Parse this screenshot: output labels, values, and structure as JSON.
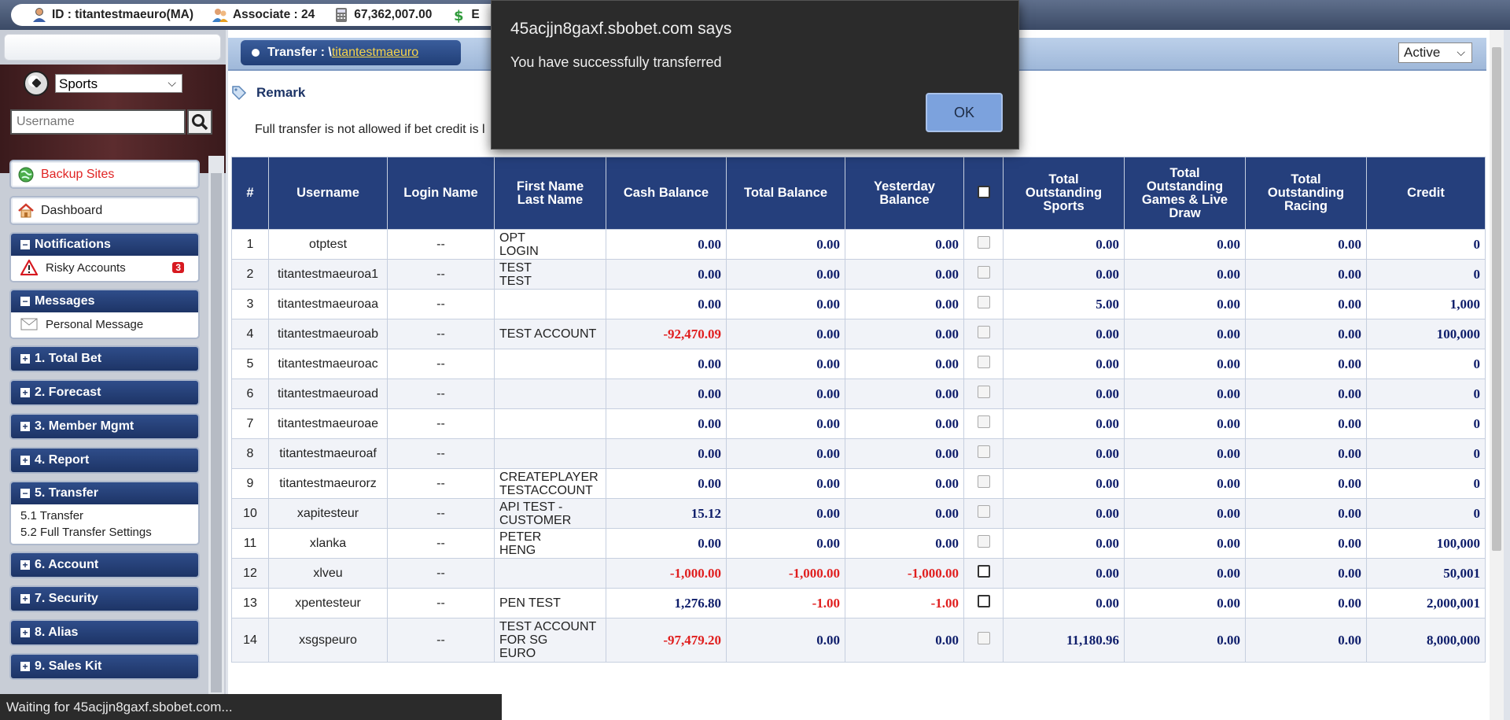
{
  "topbar": {
    "id_text": "ID : titantestmaeuro(MA)",
    "associate_text": "Associate : 24",
    "balance_text": "67,362,007.00",
    "extra_text": "E"
  },
  "sidebar": {
    "sport_selected": "Sports",
    "search_placeholder": "Username",
    "backup_label": "Backup Sites",
    "dashboard_label": "Dashboard",
    "notifications": {
      "title": "Notifications",
      "risky_label": "Risky Accounts",
      "risky_count": "3"
    },
    "messages": {
      "title": "Messages",
      "personal_label": "Personal Message"
    },
    "groups": [
      "1. Total Bet",
      "2. Forecast",
      "3. Member Mgmt",
      "4. Report"
    ],
    "transfer": {
      "title": "5. Transfer",
      "items": [
        "5.1 Transfer",
        "5.2 Full Transfer Settings"
      ]
    },
    "groups2": [
      "6. Account",
      "7. Security",
      "8. Alias",
      "9. Sales Kit"
    ]
  },
  "main": {
    "tab_prefix": "Transfer : \\",
    "tab_link": "titantestmaeuro",
    "status_selected": "Active",
    "remark_title": "Remark",
    "note": "Full transfer is not allowed if bet credit is l",
    "columns": [
      "#",
      "Username",
      "Login Name",
      "First Name\nLast Name",
      "Cash Balance",
      "Total Balance",
      "Yesterday\nBalance",
      "",
      "Total\nOutstanding\nSports",
      "Total\nOutstanding\nGames & Live\nDraw",
      "Total\nOutstanding\nRacing",
      "Credit"
    ],
    "rows": [
      {
        "no": "1",
        "user": "otptest",
        "login": "--",
        "name": "OPT\nLOGIN",
        "cash": "0.00",
        "total": "0.00",
        "yest": "0.00",
        "cb": false,
        "sports": "0.00",
        "games": "0.00",
        "racing": "0.00",
        "credit": "0"
      },
      {
        "no": "2",
        "user": "titantestmaeuroa1",
        "login": "--",
        "name": "TEST\nTEST",
        "cash": "0.00",
        "total": "0.00",
        "yest": "0.00",
        "cb": false,
        "sports": "0.00",
        "games": "0.00",
        "racing": "0.00",
        "credit": "0"
      },
      {
        "no": "3",
        "user": "titantestmaeuroaa",
        "login": "--",
        "name": "",
        "cash": "0.00",
        "total": "0.00",
        "yest": "0.00",
        "cb": false,
        "sports": "5.00",
        "games": "0.00",
        "racing": "0.00",
        "credit": "1,000"
      },
      {
        "no": "4",
        "user": "titantestmaeuroab",
        "login": "--",
        "name": "TEST ACCOUNT",
        "cash": "-92,470.09",
        "total": "0.00",
        "yest": "0.00",
        "cb": false,
        "sports": "0.00",
        "games": "0.00",
        "racing": "0.00",
        "credit": "100,000"
      },
      {
        "no": "5",
        "user": "titantestmaeuroac",
        "login": "--",
        "name": "",
        "cash": "0.00",
        "total": "0.00",
        "yest": "0.00",
        "cb": false,
        "sports": "0.00",
        "games": "0.00",
        "racing": "0.00",
        "credit": "0"
      },
      {
        "no": "6",
        "user": "titantestmaeuroad",
        "login": "--",
        "name": "",
        "cash": "0.00",
        "total": "0.00",
        "yest": "0.00",
        "cb": false,
        "sports": "0.00",
        "games": "0.00",
        "racing": "0.00",
        "credit": "0"
      },
      {
        "no": "7",
        "user": "titantestmaeuroae",
        "login": "--",
        "name": "",
        "cash": "0.00",
        "total": "0.00",
        "yest": "0.00",
        "cb": false,
        "sports": "0.00",
        "games": "0.00",
        "racing": "0.00",
        "credit": "0"
      },
      {
        "no": "8",
        "user": "titantestmaeuroaf",
        "login": "--",
        "name": "",
        "cash": "0.00",
        "total": "0.00",
        "yest": "0.00",
        "cb": false,
        "sports": "0.00",
        "games": "0.00",
        "racing": "0.00",
        "credit": "0"
      },
      {
        "no": "9",
        "user": "titantestmaeurorz",
        "login": "--",
        "name": "CREATEPLAYER\nTESTACCOUNT",
        "cash": "0.00",
        "total": "0.00",
        "yest": "0.00",
        "cb": false,
        "sports": "0.00",
        "games": "0.00",
        "racing": "0.00",
        "credit": "0"
      },
      {
        "no": "10",
        "user": "xapitesteur",
        "login": "--",
        "name": "API TEST -\nCUSTOMER",
        "cash": "15.12",
        "total": "0.00",
        "yest": "0.00",
        "cb": false,
        "sports": "0.00",
        "games": "0.00",
        "racing": "0.00",
        "credit": "0"
      },
      {
        "no": "11",
        "user": "xlanka",
        "login": "--",
        "name": "PETER\nHENG",
        "cash": "0.00",
        "total": "0.00",
        "yest": "0.00",
        "cb": false,
        "sports": "0.00",
        "games": "0.00",
        "racing": "0.00",
        "credit": "100,000"
      },
      {
        "no": "12",
        "user": "xlveu",
        "login": "--",
        "name": "",
        "cash": "-1,000.00",
        "total": "-1,000.00",
        "yest": "-1,000.00",
        "cb": true,
        "sports": "0.00",
        "games": "0.00",
        "racing": "0.00",
        "credit": "50,001"
      },
      {
        "no": "13",
        "user": "xpentesteur",
        "login": "--",
        "name": "PEN TEST",
        "cash": "1,276.80",
        "total": "-1.00",
        "yest": "-1.00",
        "cb": true,
        "sports": "0.00",
        "games": "0.00",
        "racing": "0.00",
        "credit": "2,000,001"
      },
      {
        "no": "14",
        "user": "xsgspeuro",
        "login": "--",
        "name": "TEST ACCOUNT\nFOR SG\nEURO",
        "cash": "-97,479.20",
        "total": "0.00",
        "yest": "0.00",
        "cb": false,
        "sports": "11,180.96",
        "games": "0.00",
        "racing": "0.00",
        "credit": "8,000,000"
      }
    ]
  },
  "dialog": {
    "title": "45acjjn8gaxf.sbobet.com says",
    "message": "You have successfully transferred",
    "ok_label": "OK"
  },
  "statusbar": {
    "text": "Waiting for 45acjjn8gaxf.sbobet.com..."
  },
  "colors": {
    "header_blue": "#253f7c",
    "negative_red": "#e01e1e",
    "value_navy": "#0e1d6a"
  }
}
